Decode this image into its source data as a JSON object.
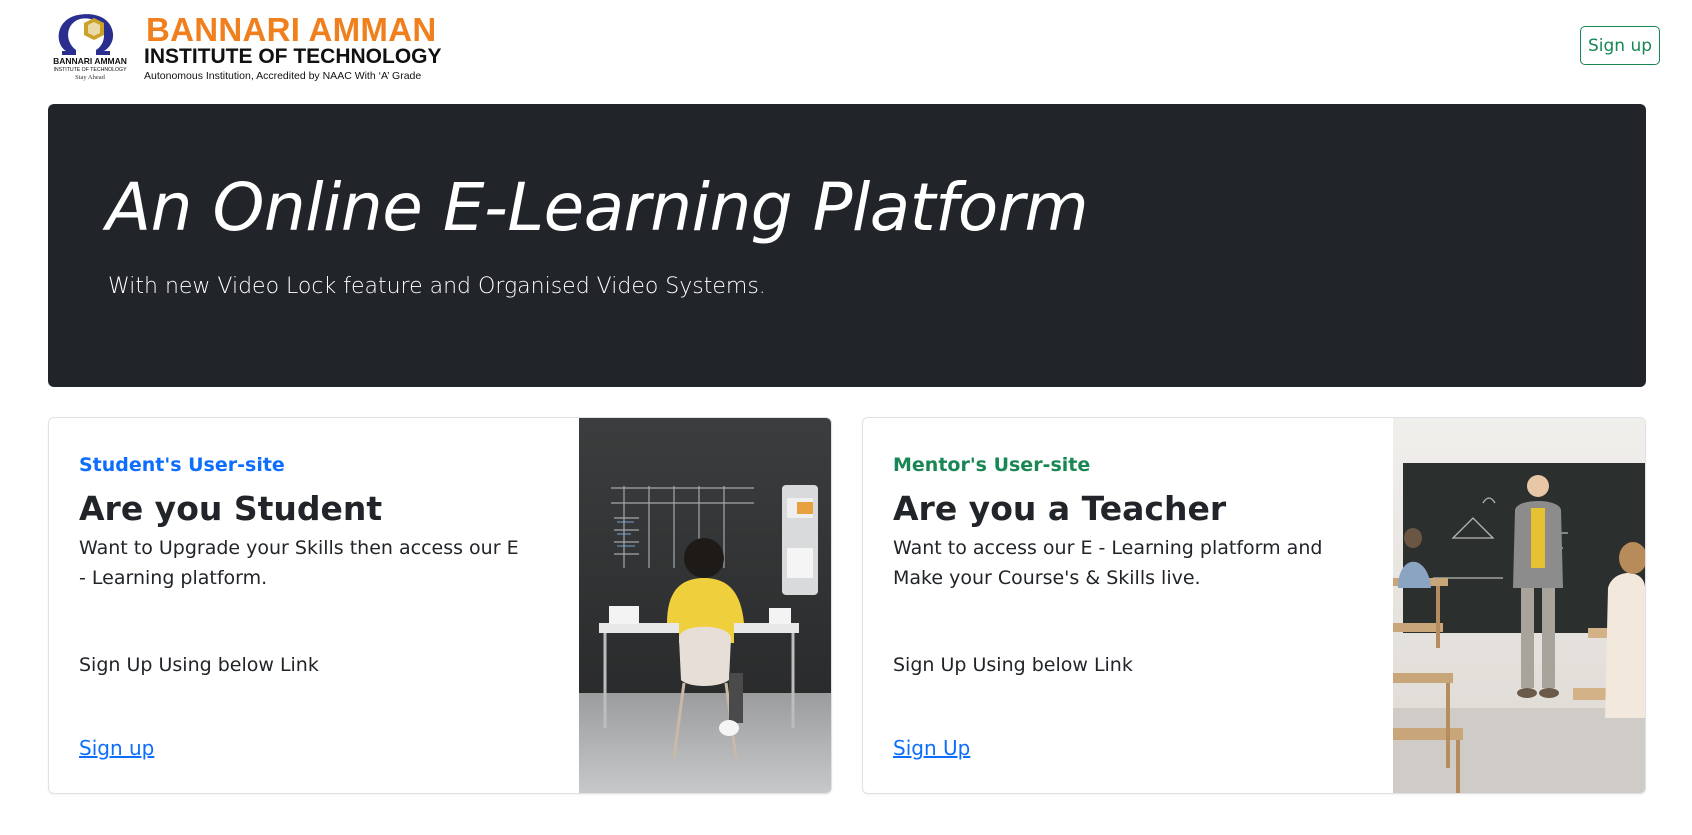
{
  "header": {
    "logo": {
      "name_line1": "BANNARI AMMAN",
      "name_line2": "INSTITUTE OF TECHNOLOGY",
      "tagline": "Autonomous Institution, Accredited by NAAC With ‘A’ Grade",
      "emblem_text_line1": "BANNARI AMMAN",
      "emblem_text_line2": "INSTITUTE OF TECHNOLOGY",
      "emblem_motto": "Stay Ahead"
    },
    "signup_label": "Sign up"
  },
  "hero": {
    "title": "An Online E-Learning Platform",
    "subtitle": "With new Video Lock feature and Organised Video Systems."
  },
  "cards": [
    {
      "kicker": "Student's User-site",
      "title": "Are you Student",
      "text": "Want to Upgrade your Skills then access our E - Learning platform.",
      "footer": "Sign Up Using below Link",
      "link_label": "Sign up",
      "image_icon": "student-at-desk-photo"
    },
    {
      "kicker": "Mentor's User-site",
      "title": "Are you a Teacher",
      "text": "Want to access our E - Learning platform and Make your Course's & Skills live.",
      "footer": "Sign Up Using below Link",
      "link_label": "Sign Up",
      "image_icon": "teacher-classroom-photo"
    }
  ],
  "colors": {
    "brand_orange": "#f0801e",
    "hero_bg": "#212529",
    "primary_blue": "#0d6efd",
    "success_green": "#198754"
  }
}
